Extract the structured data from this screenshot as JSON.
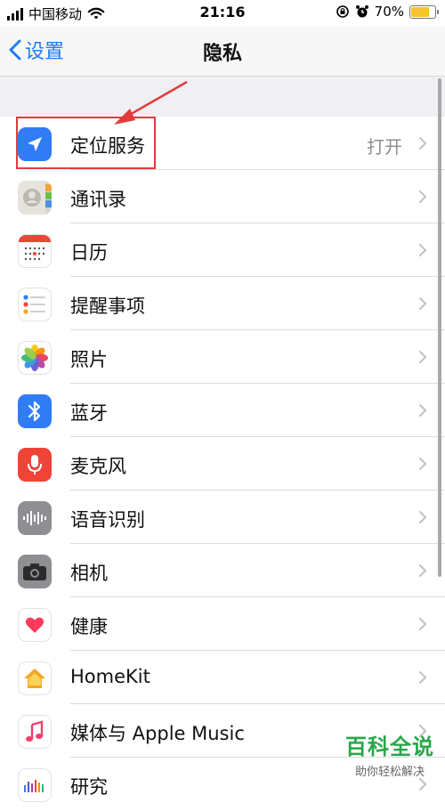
{
  "status": {
    "carrier": "中国移动",
    "time": "21:16",
    "battery": "70%",
    "battery_level": 0.7
  },
  "nav": {
    "back_label": "设置",
    "title": "隐私"
  },
  "items": [
    {
      "label": "定位服务",
      "value": "打开",
      "icon": "location-arrow-icon"
    },
    {
      "label": "通讯录",
      "value": "",
      "icon": "contacts-icon"
    },
    {
      "label": "日历",
      "value": "",
      "icon": "calendar-icon"
    },
    {
      "label": "提醒事项",
      "value": "",
      "icon": "reminders-icon"
    },
    {
      "label": "照片",
      "value": "",
      "icon": "photos-icon"
    },
    {
      "label": "蓝牙",
      "value": "",
      "icon": "bluetooth-icon"
    },
    {
      "label": "麦克风",
      "value": "",
      "icon": "microphone-icon"
    },
    {
      "label": "语音识别",
      "value": "",
      "icon": "speech-recognition-icon"
    },
    {
      "label": "相机",
      "value": "",
      "icon": "camera-icon"
    },
    {
      "label": "健康",
      "value": "",
      "icon": "health-heart-icon"
    },
    {
      "label": "HomeKit",
      "value": "",
      "icon": "homekit-house-icon"
    },
    {
      "label": "媒体与 Apple Music",
      "value": "",
      "icon": "music-note-icon"
    },
    {
      "label": "研究",
      "value": "",
      "icon": "research-icon"
    }
  ],
  "watermark": {
    "title": "百科全说",
    "subtitle": "助你轻松解决"
  },
  "colors": {
    "accent": "#1e7cf2",
    "highlight": "#e23b3b",
    "watermark": "#2aa64a"
  }
}
